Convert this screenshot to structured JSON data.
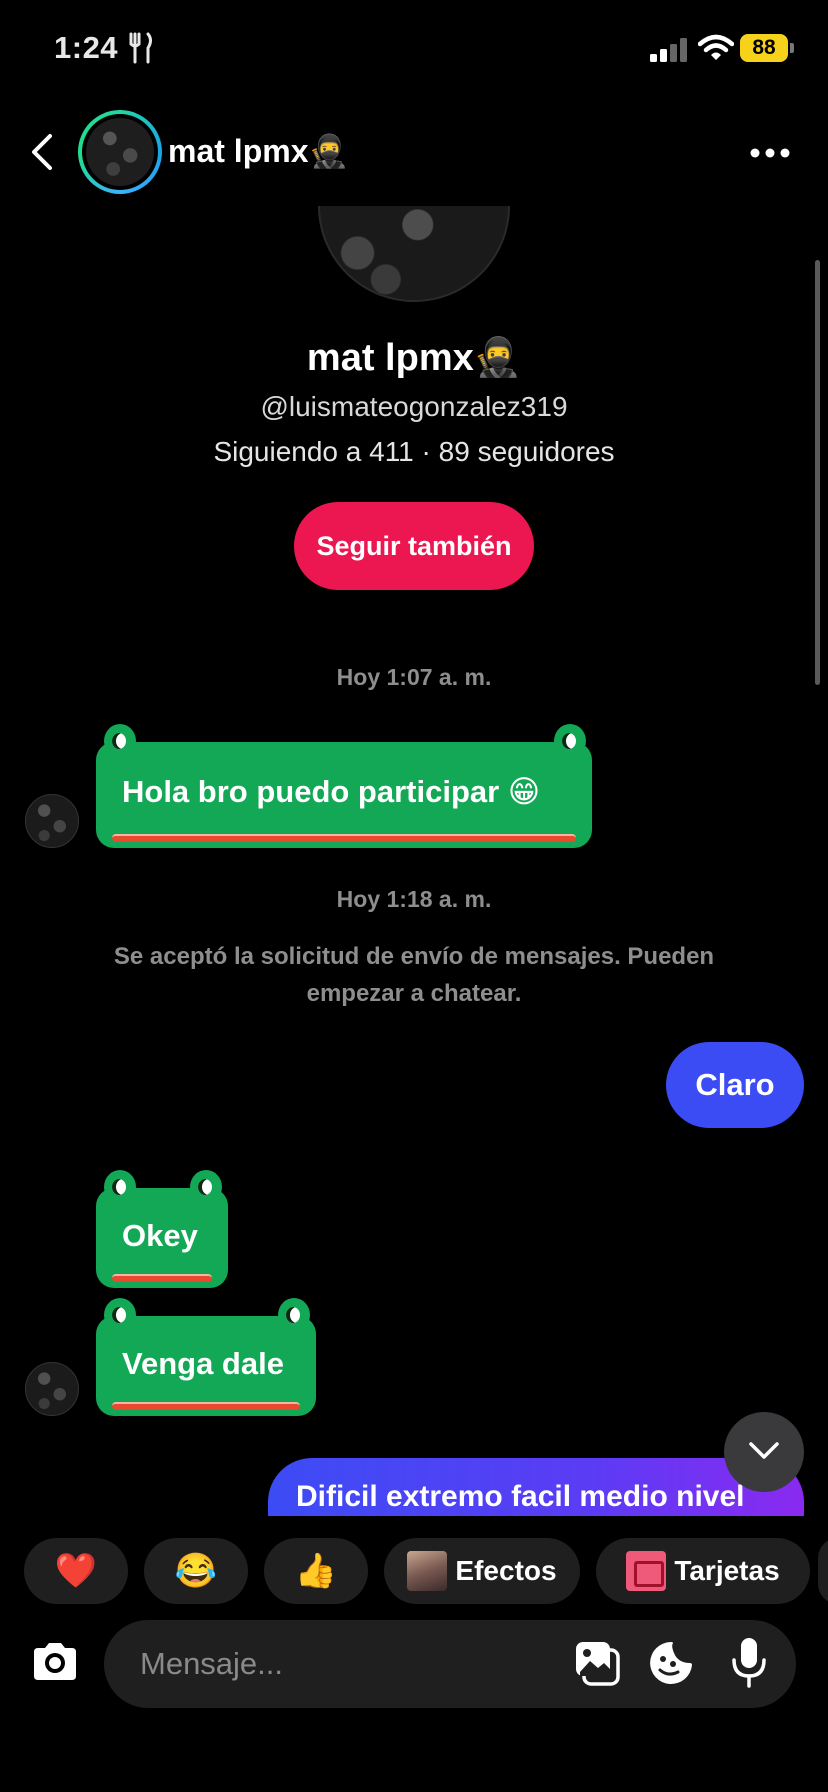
{
  "status_bar": {
    "time": "1:24",
    "battery": "88"
  },
  "header": {
    "name": "mat lpmx🥷"
  },
  "profile": {
    "name": "mat lpmx🥷",
    "handle": "@luismateogonzalez319",
    "stats": "Siguiendo a 411 · 89 seguidores",
    "follow_label": "Seguir también"
  },
  "messages": {
    "timestamp1": "Hoy 1:07 a. m.",
    "msg1": "Hola bro puedo participar 😁",
    "timestamp2": "Hoy 1:18 a. m.",
    "system": "Se aceptó la solicitud de envío de mensajes. Pueden empezar a chatear.",
    "out1": "Claro",
    "msg2": "Okey",
    "msg3": "Venga dale",
    "out2": "Dificil extremo facil medio nivel"
  },
  "chips": {
    "heart": "❤️",
    "laugh": "😂",
    "thumbs": "👍",
    "effects": "Efectos",
    "cards": "Tarjetas"
  },
  "composer": {
    "placeholder": "Mensaje..."
  },
  "colors": {
    "frog_green": "#12a856",
    "outgoing_blue": "#3c4cf5",
    "follow_red": "#ec1651",
    "battery_yellow": "#f7d21a"
  }
}
